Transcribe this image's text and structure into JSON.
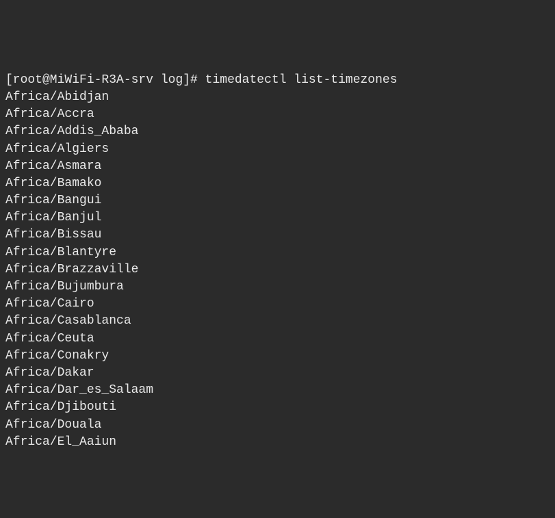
{
  "prompt": {
    "full": "[root@MiWiFi-R3A-srv log]#",
    "command": "timedatectl list-timezones"
  },
  "output": [
    "Africa/Abidjan",
    "Africa/Accra",
    "Africa/Addis_Ababa",
    "Africa/Algiers",
    "Africa/Asmara",
    "Africa/Bamako",
    "Africa/Bangui",
    "Africa/Banjul",
    "Africa/Bissau",
    "Africa/Blantyre",
    "Africa/Brazzaville",
    "Africa/Bujumbura",
    "Africa/Cairo",
    "Africa/Casablanca",
    "Africa/Ceuta",
    "Africa/Conakry",
    "Africa/Dakar",
    "Africa/Dar_es_Salaam",
    "Africa/Djibouti",
    "Africa/Douala",
    "Africa/El_Aaiun"
  ]
}
